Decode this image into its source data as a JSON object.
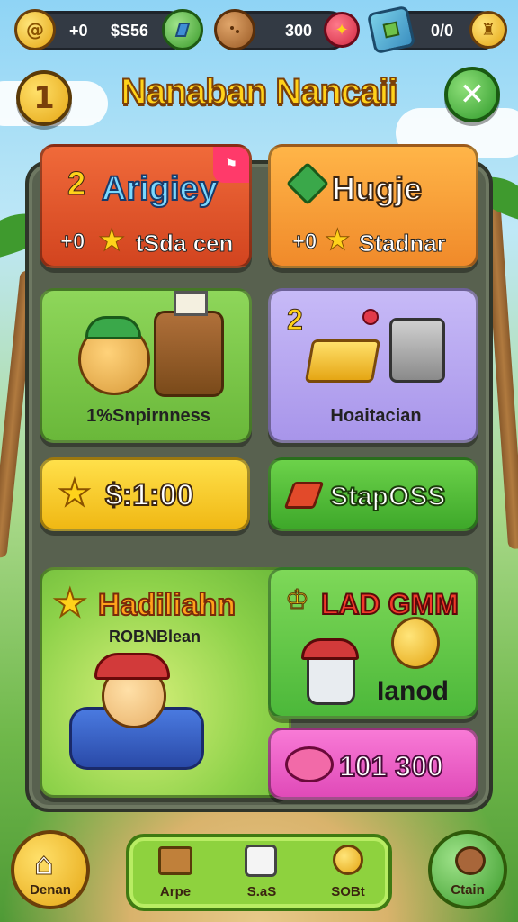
{
  "resources": [
    {
      "prefix": "+0",
      "value": "$S56"
    },
    {
      "value": "300"
    },
    {
      "value": "0/0"
    }
  ],
  "header": {
    "title": "Nanaban Nancaii",
    "level_badge": "1"
  },
  "cards": {
    "top_left": {
      "title": "Arigiey",
      "badge_num": "2",
      "reward_prefix": "+0",
      "reward_text": "tSda cen"
    },
    "top_right": {
      "title": "Hugje",
      "reward_prefix": "+0",
      "reward_text": "Stadnar"
    },
    "mid_left": {
      "label": "1%Snpirnness"
    },
    "mid_right": {
      "label": "Hoaitacian",
      "badge_num": "2"
    },
    "price_button": {
      "label": "$:1:00"
    },
    "stapos_button": {
      "label": "StapOSS"
    },
    "featured": {
      "title": "Hadiliahn",
      "subtitle": "ROBNBlean"
    },
    "lad_gmm": {
      "title": "LAD GMM",
      "subtitle": "Ianod"
    },
    "piggy": {
      "value": "101 300"
    }
  },
  "nav": {
    "home": "Denan",
    "items": [
      "Arpe",
      "S.aS",
      "SOBt"
    ],
    "right": "Ctain"
  },
  "colors": {
    "orange_red": "#e2562a",
    "orange": "#f5a43a",
    "green": "#7cc545",
    "lavender": "#b8a9f0",
    "yellow": "#ffd328",
    "pink": "#f061c8"
  }
}
